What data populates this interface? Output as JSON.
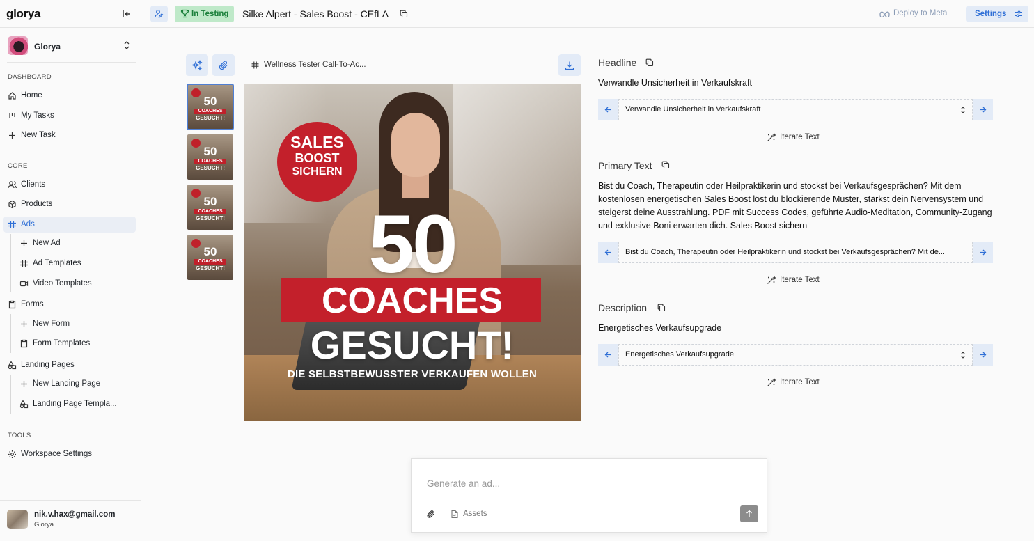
{
  "app": {
    "logo": "glorya"
  },
  "workspace": {
    "name": "Glorya"
  },
  "sidebar": {
    "sections": {
      "dashboard": "DASHBOARD",
      "core": "CORE",
      "tools": "TOOLS"
    },
    "items": {
      "home": "Home",
      "my_tasks": "My Tasks",
      "new_task": "New Task",
      "clients": "Clients",
      "products": "Products",
      "ads": "Ads",
      "new_ad": "New Ad",
      "ad_templates": "Ad Templates",
      "video_templates": "Video Templates",
      "forms": "Forms",
      "new_form": "New Form",
      "form_templates": "Form Templates",
      "landing_pages": "Landing Pages",
      "new_landing_page": "New Landing Page",
      "landing_page_templates": "Landing Page Templa...",
      "workspace_settings": "Workspace Settings"
    },
    "active": "ads"
  },
  "user": {
    "email": "nik.v.hax@gmail.com",
    "org": "Glorya"
  },
  "header": {
    "status": "In Testing",
    "title": "Silke Alpert - Sales Boost - CEfLA",
    "deploy": "Deploy to Meta",
    "settings": "Settings"
  },
  "ad_editor": {
    "template_name": "Wellness Tester Call-To-Ac...",
    "thumbnails": [
      {
        "big": "50",
        "bar": "COACHES",
        "sub": "GESUCHT!",
        "selected": true
      },
      {
        "big": "50",
        "bar": "COACHES",
        "sub": "GESUCHT!",
        "selected": false
      },
      {
        "big": "50",
        "bar": "COACHES",
        "sub": "GESUCHT!",
        "selected": false
      },
      {
        "big": "50",
        "bar": "COACHES",
        "sub": "GESUCHT!",
        "selected": false
      }
    ],
    "creative": {
      "badge_line1": "SALES",
      "badge_line2": "BOOST",
      "badge_line3": "SICHERN",
      "big_number": "50",
      "bar_text": "COACHES",
      "headline": "GESUCHT!",
      "subline": "DIE SELBSTBEWUSSTER VERKAUFEN WOLLEN"
    }
  },
  "fields": {
    "headline": {
      "title": "Headline",
      "value": "Verwandle Unsicherheit in Verkaufskraft",
      "selected": "Verwandle Unsicherheit in Verkaufskraft",
      "iterate": "Iterate Text"
    },
    "primary": {
      "title": "Primary Text",
      "value": "Bist du Coach, Therapeutin oder Heilpraktikerin und stockst bei Verkaufsgesprächen? Mit dem kostenlosen energetischen Sales Boost löst du blockierende Muster, stärkst dein Nervensystem und steigerst deine Ausstrahlung. PDF mit Success Codes, geführte Audio-Meditation, Community-Zugang und exklusive Boni erwarten dich. Sales Boost sichern",
      "selected": "Bist du Coach, Therapeutin oder Heilpraktikerin und stockst bei Verkaufsgesprächen? Mit de...",
      "iterate": "Iterate Text"
    },
    "description": {
      "title": "Description",
      "value": "Energetisches Verkaufsupgrade",
      "selected": "Energetisches Verkaufsupgrade",
      "iterate": "Iterate Text"
    }
  },
  "prompt": {
    "placeholder": "Generate an ad...",
    "assets": "Assets"
  },
  "colors": {
    "accent": "#2f6fd6",
    "accent_bg": "#e3ebf7",
    "status_bg": "#bfe9c9",
    "status_fg": "#1a7f3a",
    "ad_red": "#c3202b"
  }
}
